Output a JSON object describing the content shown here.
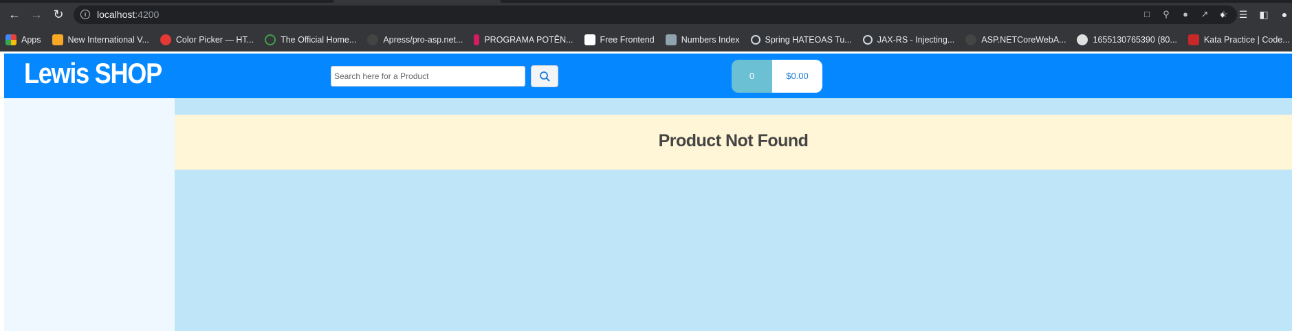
{
  "browser": {
    "url_host": "localhost",
    "url_port": ":4200",
    "bookmarks": [
      {
        "label": "Apps",
        "color": "#4285f4"
      },
      {
        "label": "New International V...",
        "color": "#f9a825"
      },
      {
        "label": "Color Picker — HT...",
        "color": "#e53935"
      },
      {
        "label": "The Official Home...",
        "color": "#43a047"
      },
      {
        "label": "Apress/pro-asp.net...",
        "color": "#444444"
      },
      {
        "label": "PROGRAMA POTÊN...",
        "color": "#d81b60"
      },
      {
        "label": "Free Frontend",
        "color": "#ffffff"
      },
      {
        "label": "Numbers Index",
        "color": "#90a4ae"
      },
      {
        "label": "Spring HATEOAS Tu...",
        "color": "#cfd8dc"
      },
      {
        "label": "JAX-RS - Injecting...",
        "color": "#cfd8dc"
      },
      {
        "label": "ASP.NETCoreWebA...",
        "color": "#444444"
      },
      {
        "label": "1655130765390 (80...",
        "color": "#e0e0e0"
      },
      {
        "label": "Kata Practice | Code...",
        "color": "#c62828"
      }
    ]
  },
  "header": {
    "brand": "Lewis SHOP",
    "search_placeholder": "Search here for a Product",
    "cart_count": "0",
    "cart_total": "$0.00"
  },
  "main": {
    "message": "Product Not Found"
  },
  "colors": {
    "navbar": "#0588ff",
    "main_bg": "#bee6f8",
    "alert_bg": "#fef6d6",
    "sidebar_bg": "#eff7ff"
  }
}
